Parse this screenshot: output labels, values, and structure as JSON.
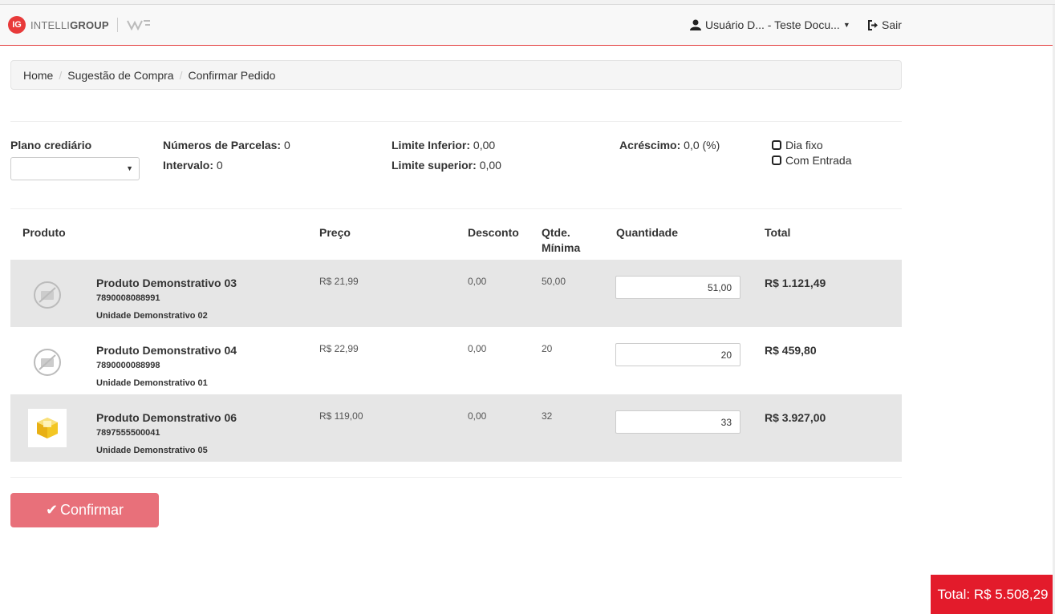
{
  "header": {
    "logo_badge": "IG",
    "logo_prefix": "INTELLI",
    "logo_bold": "GROUP",
    "user_label": "Usuário D... - Teste Docu...",
    "logout_label": "Sair"
  },
  "breadcrumb": [
    "Home",
    "Sugestão de Compra",
    "Confirmar Pedido"
  ],
  "form": {
    "plano_label": "Plano crediário",
    "plano_value": "",
    "parcelas_label": "Números de Parcelas:",
    "parcelas_value": "0",
    "intervalo_label": "Intervalo:",
    "intervalo_value": "0",
    "lim_inf_label": "Limite Inferior:",
    "lim_inf_value": "0,00",
    "lim_sup_label": "Limite superior:",
    "lim_sup_value": "0,00",
    "acrescimo_label": "Acréscimo:",
    "acrescimo_value": "0,0 (%)",
    "dia_fixo_label": "Dia fixo",
    "com_entrada_label": "Com Entrada"
  },
  "table": {
    "headers": {
      "produto": "Produto",
      "preco": "Preço",
      "desconto": "Desconto",
      "qtde_minima_1": "Qtde.",
      "qtde_minima_2": "Mínima",
      "quantidade": "Quantidade",
      "total": "Total"
    },
    "rows": [
      {
        "name": "Produto Demonstrativo 03",
        "code": "7890008088991",
        "unit": "Unidade Demonstrativo 02",
        "price": "R$ 21,99",
        "discount": "0,00",
        "min_qty": "50,00",
        "qty": "51,00",
        "total": "R$ 1.121,49",
        "image": "no-image-icon"
      },
      {
        "name": "Produto Demonstrativo 04",
        "code": "7890000088998",
        "unit": "Unidade Demonstrativo 01",
        "price": "R$ 22,99",
        "discount": "0,00",
        "min_qty": "20",
        "qty": "20",
        "total": "R$ 459,80",
        "image": "no-image-icon"
      },
      {
        "name": "Produto Demonstrativo 06",
        "code": "7897555500041",
        "unit": "Unidade Demonstrativo 05",
        "price": "R$ 119,00",
        "discount": "0,00",
        "min_qty": "32",
        "qty": "33",
        "total": "R$ 3.927,00",
        "image": "product-box-image"
      }
    ]
  },
  "confirm_label": "Confirmar",
  "grand_total": "Total: R$ 5.508,29",
  "colors": {
    "accent": "#e31b2b",
    "confirm": "#e8707a",
    "stripe": "#e6e6e6"
  }
}
